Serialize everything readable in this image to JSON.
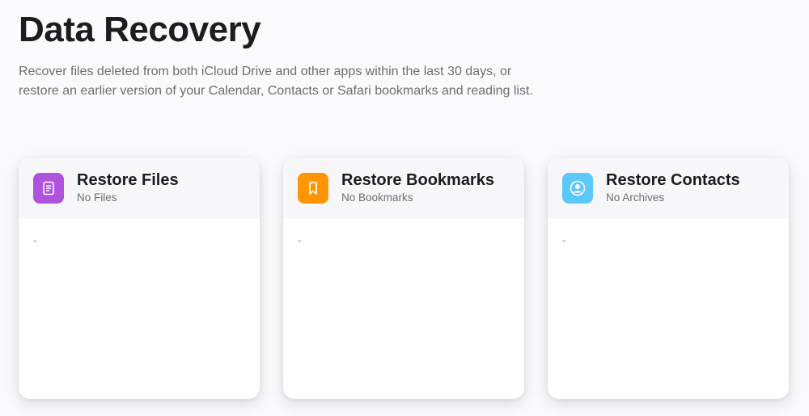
{
  "page": {
    "title": "Data Recovery",
    "description": "Recover files deleted from both iCloud Drive and other apps within the last 30 days, or restore an earlier version of your Calendar, Contacts or Safari bookmarks and reading list."
  },
  "cards": [
    {
      "title": "Restore Files",
      "subtitle": "No Files",
      "icon": "document-icon",
      "icon_color": "#af52de",
      "content": "-"
    },
    {
      "title": "Restore Bookmarks",
      "subtitle": "No Bookmarks",
      "icon": "bookmark-icon",
      "icon_color": "#ff9500",
      "content": "-"
    },
    {
      "title": "Restore Contacts",
      "subtitle": "No Archives",
      "icon": "contact-icon",
      "icon_color": "#5ac8fa",
      "content": "-"
    }
  ]
}
